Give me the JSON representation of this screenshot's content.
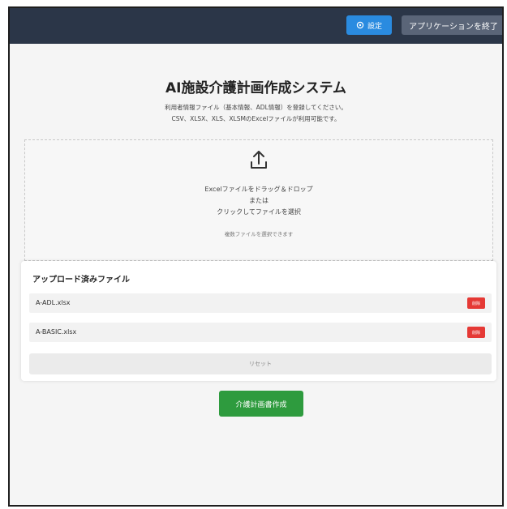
{
  "header": {
    "settings_label": "設定",
    "quit_label": "アプリケーションを終了"
  },
  "page": {
    "title": "AI施設介護計画作成システム",
    "description_line1": "利用者情報ファイル（基本情報、ADL情報）を登録してください。",
    "description_line2": "CSV、XLSX、XLS、XLSMのExcelファイルが利用可能です。"
  },
  "dropzone": {
    "line1": "Excelファイルをドラッグ＆ドロップ",
    "line2": "または",
    "line3": "クリックしてファイルを選択",
    "hint": "複数ファイルを選択できます"
  },
  "uploaded": {
    "heading": "アップロード済みファイル",
    "files": [
      {
        "name": "A-ADL.xlsx",
        "delete_label": "削除"
      },
      {
        "name": "A-BASIC.xlsx",
        "delete_label": "削除"
      }
    ],
    "reset_label": "リセット"
  },
  "actions": {
    "create_label": "介護計画書作成"
  },
  "colors": {
    "header_bg": "#2b3648",
    "settings_button": "#2a8be0",
    "quit_button": "#5a6578",
    "delete_button": "#e53935",
    "create_button": "#2e9b3e"
  }
}
